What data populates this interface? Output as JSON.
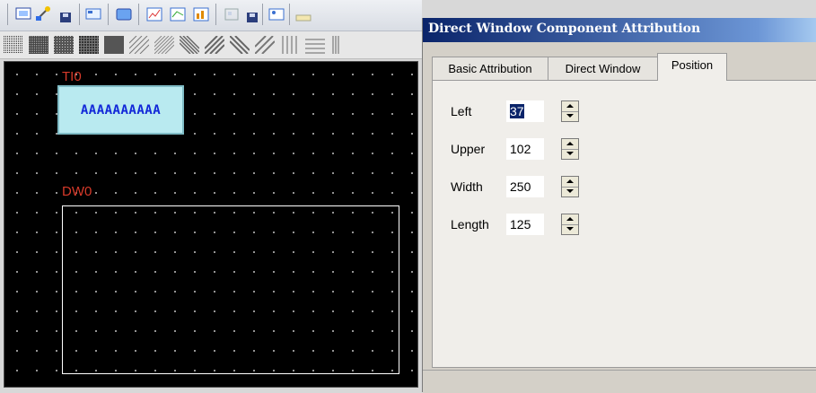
{
  "dialog": {
    "title": "Direct Window Component Attribution",
    "tabs": [
      {
        "label": "Basic Attribution"
      },
      {
        "label": "Direct Window"
      },
      {
        "label": "Position",
        "active": true
      }
    ],
    "fields": [
      {
        "label": "Left",
        "value": "37",
        "selected": true
      },
      {
        "label": "Upper",
        "value": "102"
      },
      {
        "label": "Width",
        "value": "250"
      },
      {
        "label": "Length",
        "value": "125"
      }
    ]
  },
  "canvas": {
    "text_input_label": "TI0",
    "text_input_content": "AAAAAAAAAA",
    "direct_window_label": "DW0"
  },
  "colors": {
    "title_bar_start": "#0a246a",
    "canvas_bg": "#000000",
    "component_label": "#d83a2a",
    "text_input_bg": "#b9eaf0",
    "text_input_fg": "#1228d8"
  }
}
